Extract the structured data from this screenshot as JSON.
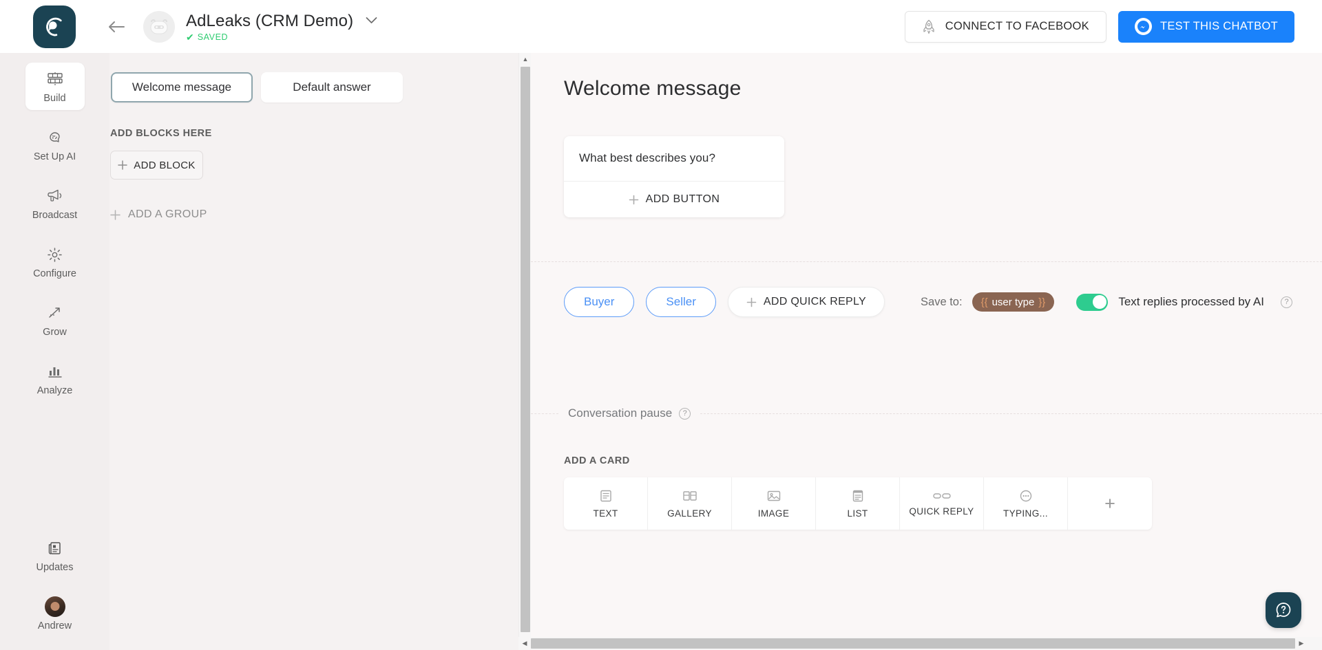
{
  "header": {
    "brand_icon": "chat-bubble-logo",
    "back_icon": "arrow-left-icon",
    "bot_avatar_icon": "bot-avatar-icon",
    "title": "AdLeaks (CRM Demo)",
    "chevron_icon": "chevron-down-icon",
    "saved_check": "✔",
    "saved_label": "SAVED",
    "connect_button": "CONNECT TO FACEBOOK",
    "connect_icon": "rocket-icon",
    "test_button": "TEST THIS CHATBOT",
    "test_icon": "messenger-icon",
    "accent_blue": "#1a82fb",
    "brand_dark": "#1b4353",
    "saved_green": "#2fcc71"
  },
  "sidebar": {
    "items": [
      {
        "label": "Build",
        "icon": "blocks-icon",
        "active": true
      },
      {
        "label": "Set Up AI",
        "icon": "brain-icon",
        "active": false
      },
      {
        "label": "Broadcast",
        "icon": "megaphone-icon",
        "active": false
      },
      {
        "label": "Configure",
        "icon": "gear-icon",
        "active": false
      },
      {
        "label": "Grow",
        "icon": "trending-up-icon",
        "active": false
      },
      {
        "label": "Analyze",
        "icon": "bar-chart-icon",
        "active": false
      }
    ],
    "bottom": [
      {
        "label": "Updates",
        "icon": "updates-icon"
      },
      {
        "label": "Andrew",
        "icon": "user-avatar"
      }
    ]
  },
  "left_panel": {
    "tabs": [
      {
        "label": "Welcome message",
        "active": true
      },
      {
        "label": "Default answer",
        "active": false
      }
    ],
    "blocks_caption": "ADD BLOCKS HERE",
    "add_block_label": "ADD BLOCK",
    "add_block_icon": "plus-icon",
    "add_group_label": "ADD A GROUP",
    "add_group_icon": "plus-icon"
  },
  "main": {
    "title": "Welcome message",
    "message_card": {
      "text": "What best describes you?",
      "add_button_label": "ADD BUTTON",
      "add_button_icon": "plus-icon"
    },
    "quick_replies": [
      {
        "label": "Buyer"
      },
      {
        "label": "Seller"
      }
    ],
    "add_quick_reply_label": "ADD QUICK REPLY",
    "add_quick_reply_icon": "plus-icon",
    "save_to_label": "Save to:",
    "save_to_variable": "user type",
    "variable_open_brace": "{{",
    "variable_close_brace": "}}",
    "variable_chip_color": "#8a6552",
    "ai_toggle_label": "Text replies processed by AI",
    "ai_toggle_on": true,
    "ai_toggle_color": "#2ecc8f",
    "ai_help_icon": "question-circle-icon",
    "pause_label": "Conversation pause",
    "pause_help_icon": "question-circle-icon",
    "add_card_caption": "ADD A CARD",
    "card_types": [
      {
        "label": "TEXT",
        "icon": "text-card-icon"
      },
      {
        "label": "GALLERY",
        "icon": "gallery-card-icon"
      },
      {
        "label": "IMAGE",
        "icon": "image-card-icon"
      },
      {
        "label": "LIST",
        "icon": "list-card-icon"
      },
      {
        "label": "QUICK REPLY",
        "icon": "quick-reply-card-icon"
      },
      {
        "label": "TYPING...",
        "icon": "typing-card-icon"
      }
    ],
    "more_cards_icon": "plus-icon"
  },
  "help_button": {
    "icon": "help-question-icon"
  },
  "scrollbars": {
    "vertical_up_icon": "▲",
    "vertical_down_icon": "▼",
    "horizontal_left_icon": "◀",
    "horizontal_right_icon": "▶"
  }
}
